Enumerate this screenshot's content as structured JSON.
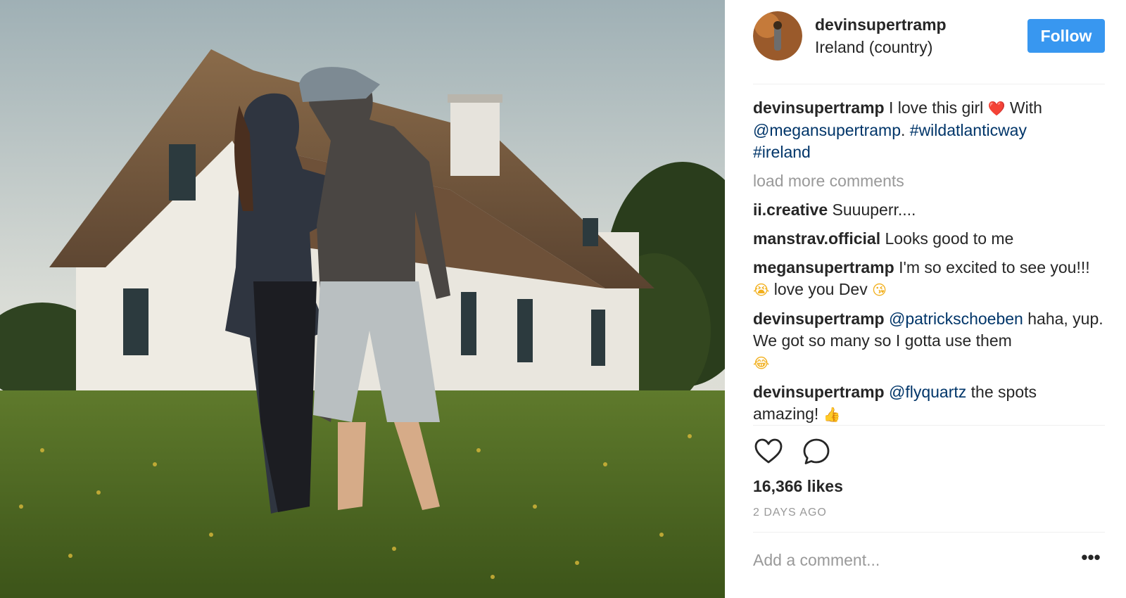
{
  "post": {
    "username": "devinsupertramp",
    "location": "Ireland (country)",
    "follow_label": "Follow",
    "caption": {
      "username": "devinsupertramp",
      "text_1": "I love this girl",
      "heart_emoji": "❤️",
      "text_2": "With",
      "mention": "@megansupertramp",
      "punct": ".",
      "hashtag_1": "#wildatlanticway",
      "hashtag_2": "#ireland"
    },
    "load_more": "load more comments",
    "comments": [
      {
        "username": "ii.creative",
        "text": "Suuuperr...."
      },
      {
        "username": "manstrav.official",
        "text": "Looks good to me"
      },
      {
        "username": "megansupertramp",
        "text": "I'm so excited to see you!!!",
        "emoji_1": "😭",
        "text_2": "love you Dev",
        "emoji_2": "😘"
      },
      {
        "username": "devinsupertramp",
        "mention": "@patrickschoeben",
        "text": "haha, yup. We got so many so I gotta use them",
        "emoji": "😂"
      },
      {
        "username": "devinsupertramp",
        "mention": "@flyquartz",
        "text": "the spots amazing!",
        "emoji": "👍"
      }
    ],
    "likes": "16,366 likes",
    "time_ago": "2 DAYS AGO",
    "add_comment_placeholder": "Add a comment...",
    "more_label": "•••"
  },
  "icons": {
    "like": "heart-outline-icon",
    "comment": "speech-bubble-icon",
    "more": "ellipsis-icon"
  },
  "colors": {
    "follow_button": "#3897f0",
    "link": "#003569",
    "muted": "#999999",
    "text": "#262626",
    "divider": "#efefef"
  }
}
